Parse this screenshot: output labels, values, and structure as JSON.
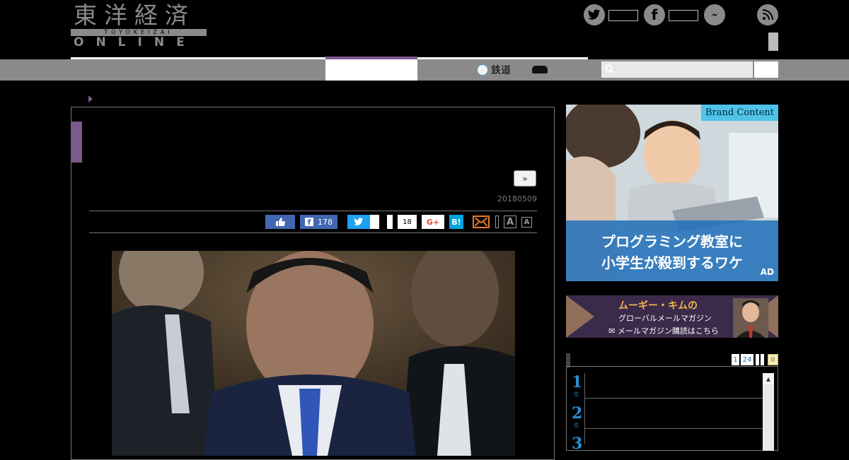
{
  "header": {
    "logo": {
      "kanji": "東洋経済",
      "romaji": "TOYOKEIZAI",
      "online": "ONLINE"
    },
    "social": [
      {
        "name": "twitter",
        "icon": "twitter-icon"
      },
      {
        "name": "facebook",
        "icon": "facebook-icon"
      },
      {
        "name": "messenger",
        "icon": "messenger-icon"
      },
      {
        "name": "rss",
        "icon": "rss-icon"
      }
    ]
  },
  "nav": {
    "tetsudo_label": "鉄道",
    "search": {
      "placeholder": ""
    }
  },
  "article": {
    "next_label": "»",
    "date": "20180509",
    "share": {
      "facebook_count": "178",
      "hatebu_count": "18",
      "gplus_label": "G+",
      "hatena_label": "B!"
    },
    "font_large": "A",
    "font_small": "A"
  },
  "sidebar": {
    "ad_brand": {
      "badge": "Brand Content",
      "line1": "プログラミング教室に",
      "line2": "小学生が殺到するワケ",
      "mark": "AD"
    },
    "ad_mail": {
      "title": "ムーギー・キムの",
      "subtitle": "グローバルメールマガジン",
      "cta": "✉ メールマガジン購読はこちら"
    },
    "ranking": {
      "pages": [
        "1",
        "24"
      ],
      "toggle": "II",
      "ranks": [
        "1",
        "2",
        "3"
      ],
      "unit": "位"
    }
  },
  "colors": {
    "accent": "#7b5a8d",
    "facebook": "#4267b2",
    "twitter": "#1da1f2",
    "hatena": "#00a4de",
    "rank": "#2a8fd6"
  }
}
